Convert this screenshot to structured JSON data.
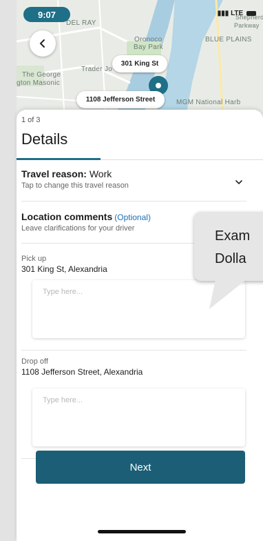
{
  "status_bar": {
    "time": "9:07",
    "network": "LTE"
  },
  "map": {
    "labels": {
      "del_ray": "DEL RAY",
      "oronoco": "Oronoco",
      "bay_park": "Bay Park",
      "blue_plains": "BLUE PLAINS",
      "trader": "Trader Jo",
      "george": "The George",
      "masonic": "gton Masonic",
      "mgm": "MGM National Harb",
      "parkway": "Parkway",
      "shepherd": "Shepherd"
    },
    "pins": {
      "pickup": "301 King St",
      "dropoff": "1108 Jefferson Street"
    }
  },
  "sheet": {
    "pager": "1 of 3",
    "title": "Details",
    "travel_reason": {
      "label": "Travel reason:",
      "value": "Work",
      "hint": "Tap to change this travel reason"
    },
    "location_comments": {
      "title": "Location comments",
      "optional": "(Optional)",
      "hint": "Leave clarifications for your driver"
    },
    "pickup": {
      "label": "Pick up",
      "address": "301 King St, Alexandria",
      "placeholder": "Type here..."
    },
    "dropoff": {
      "label": "Drop off",
      "address": "1108 Jefferson Street, Alexandria",
      "placeholder": "Type here..."
    },
    "next_label": "Next"
  },
  "callout": {
    "line1": "Exam",
    "line2": "Dolla"
  },
  "colors": {
    "primary": "#1b5e75",
    "accent": "#1e6f87",
    "link": "#1e6fb5"
  }
}
